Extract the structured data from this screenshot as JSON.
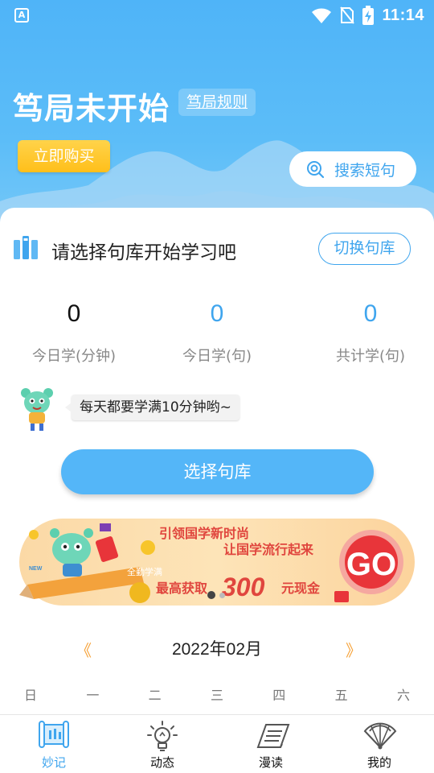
{
  "status_bar": {
    "left_badge": "A",
    "time": "11:14"
  },
  "header": {
    "title": "笃局未开始",
    "rules_link": "笃局规则",
    "buy_button": "立即购买",
    "search_button": "搜索短句"
  },
  "library": {
    "prompt": "请选择句库开始学习吧",
    "switch_button": "切换句库"
  },
  "stats": [
    {
      "value": "0",
      "label": "今日学(分钟)"
    },
    {
      "value": "0",
      "label": "今日学(句)"
    },
    {
      "value": "0",
      "label": "共计学(句)"
    }
  ],
  "tip": {
    "message": "每天都要学满10分钟哟~"
  },
  "select_button": "选择句库",
  "banner": {
    "line1": "引领国学新时尚",
    "line2": "让国学流行起来",
    "tag": "全勤学满",
    "prefix": "最高获取",
    "amount": "300",
    "suffix": "元现金",
    "go": "GO",
    "badge": "NEW"
  },
  "calendar": {
    "prev": "《",
    "next": "》",
    "month": "2022年02月",
    "weekdays": [
      "日",
      "一",
      "二",
      "三",
      "四",
      "五",
      "六"
    ]
  },
  "tabs": [
    {
      "label": "妙记",
      "icon": "book-open-icon",
      "active": true
    },
    {
      "label": "动态",
      "icon": "lightbulb-icon",
      "active": false
    },
    {
      "label": "漫读",
      "icon": "reading-book-icon",
      "active": false
    },
    {
      "label": "我的",
      "icon": "fan-icon",
      "active": false
    }
  ],
  "colors": {
    "primary": "#3fa5ee",
    "header": "#4fb4f8",
    "accent_yellow": "#ffc21f",
    "accent_orange": "#f6a33a",
    "banner_red": "#e8353a"
  }
}
